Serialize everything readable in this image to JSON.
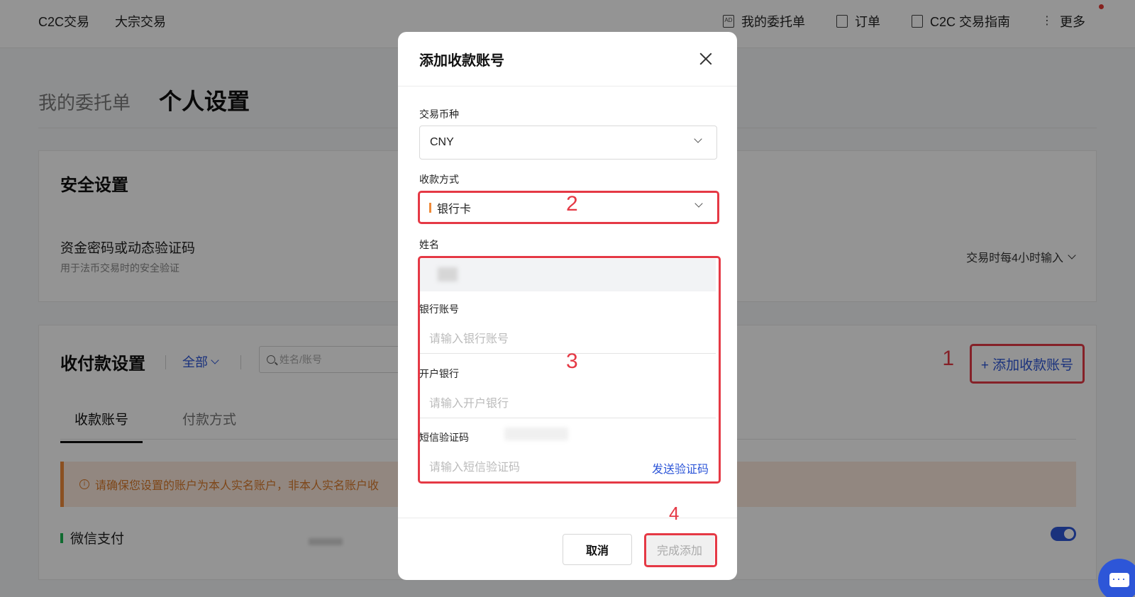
{
  "topnav": {
    "left_items": [
      "C2C交易",
      "大宗交易"
    ],
    "right_items": [
      {
        "label": "我的委托单",
        "icon": "ad-icon"
      },
      {
        "label": "订单",
        "icon": "document-icon"
      },
      {
        "label": "C2C 交易指南",
        "icon": "book-icon"
      },
      {
        "label": "更多",
        "icon": "more-dots-icon"
      }
    ]
  },
  "page_tabs": {
    "orders": "我的委托单",
    "settings": "个人设置"
  },
  "security": {
    "title": "安全设置",
    "row_label": "资金密码或动态验证码",
    "row_sub": "用于法币交易时的安全验证",
    "row_value": "交易时每4小时输入"
  },
  "payment": {
    "title": "收付款设置",
    "filter": "全部",
    "search_placeholder": "姓名/账号",
    "add_button": "+ 添加收款账号",
    "tabs": [
      "收款账号",
      "付款方式"
    ],
    "notice": "请确保您设置的账户为本人实名账户，非本人实名账户收",
    "wechat": "微信支付",
    "wechat_enabled": true
  },
  "modal": {
    "title": "添加收款账号",
    "currency_label": "交易币种",
    "currency_value": "CNY",
    "method_label": "收款方式",
    "method_value": "银行卡",
    "name_label": "姓名",
    "bank_account_label": "银行账号",
    "bank_account_placeholder": "请输入银行账号",
    "bank_name_label": "开户银行",
    "bank_name_placeholder": "请输入开户银行",
    "sms_label": "短信验证码",
    "sms_placeholder": "请输入短信验证码",
    "send_code": "发送验证码",
    "cancel": "取消",
    "confirm": "完成添加"
  },
  "annotations": {
    "step1": "1",
    "step2": "2",
    "step3": "3",
    "step4": "4"
  },
  "colors": {
    "accent": "#2d56d8",
    "annotation": "#e53945",
    "notice": "#d97a2b",
    "wechat": "#1db954"
  }
}
